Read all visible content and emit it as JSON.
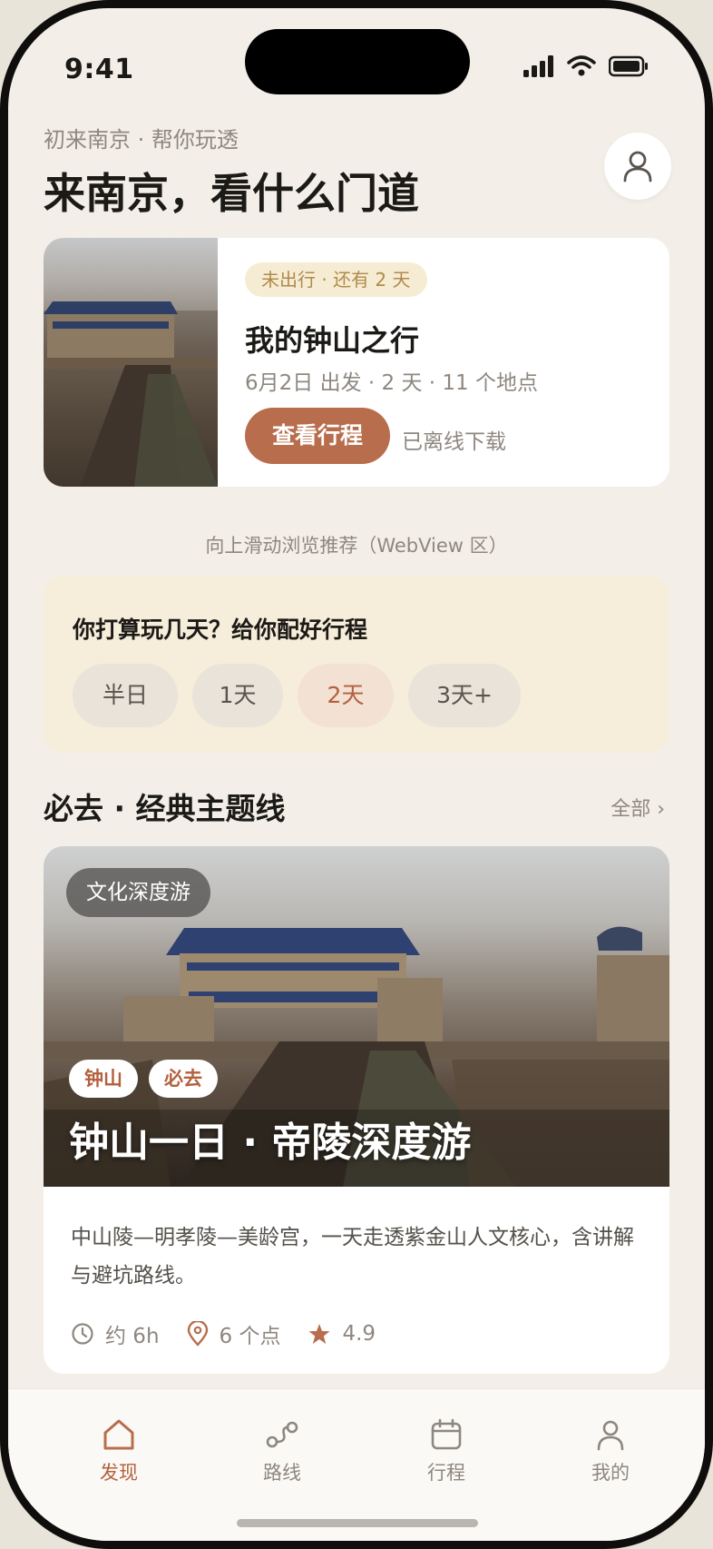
{
  "status": {
    "time": "9:41"
  },
  "header": {
    "subtitle": "初来南京 · 帮你玩透",
    "title": "来南京，看什么门道"
  },
  "trip": {
    "badge": "未出行 · 还有 2 天",
    "title": "我的钟山之行",
    "meta": "6月2日 出发 · 2 天 · 11 个地点",
    "button": "查看行程",
    "offline": "已离线下载"
  },
  "hint": "向上滑动浏览推荐（WebView 区）",
  "days": {
    "question": "你打算玩几天？给你配好行程",
    "options": [
      "半日",
      "1天",
      "2天",
      "3天+"
    ],
    "selected": "2天"
  },
  "section": {
    "title": "必去 · 经典主题线",
    "more": "全部 ›"
  },
  "route": {
    "badge": "文化深度游",
    "tags": [
      "钟山",
      "必去"
    ],
    "title": "钟山一日 · 帝陵深度游",
    "desc": "中山陵—明孝陵—美龄宫，一天走透紫金山人文核心，含讲解与避坑路线。",
    "duration": "约 6h",
    "spots": "6 个点",
    "rating": "4.9"
  },
  "tabs": [
    {
      "label": "发现",
      "icon": "home-icon",
      "active": true
    },
    {
      "label": "路线",
      "icon": "route-icon",
      "active": false
    },
    {
      "label": "行程",
      "icon": "calendar-icon",
      "active": false
    },
    {
      "label": "我的",
      "icon": "user-icon",
      "active": false
    }
  ],
  "colors": {
    "accent": "#b86d4d",
    "background": "#f3efe8",
    "card": "#ffffff",
    "days_card": "#f6eedb"
  }
}
